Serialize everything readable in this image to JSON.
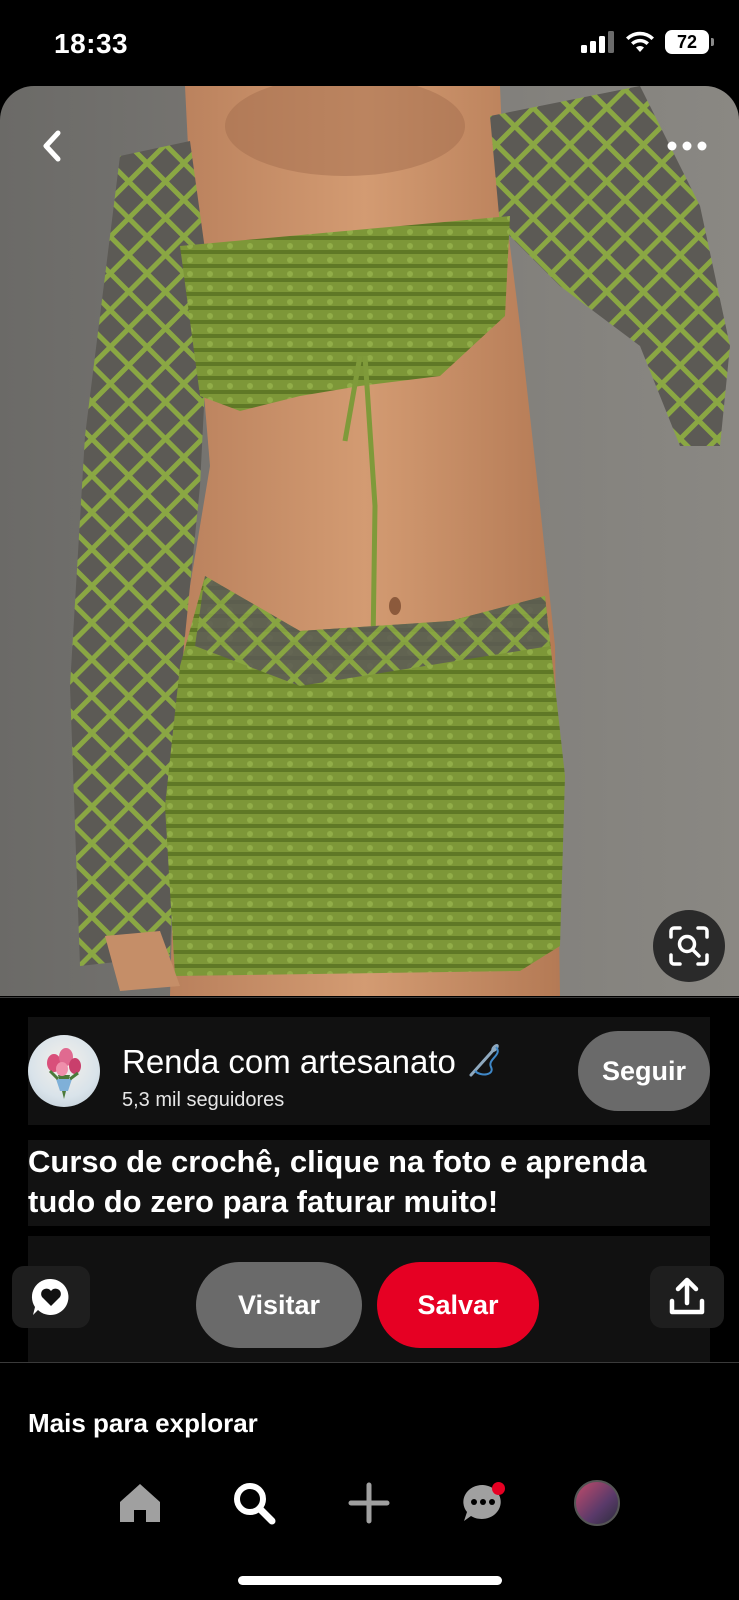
{
  "status_bar": {
    "time": "18:33",
    "battery": "72"
  },
  "pin": {
    "creator_name": "Renda com artesanato",
    "creator_followers": "5,3 mil seguidores",
    "follow_label": "Seguir",
    "description": "Curso de crochê, clique na foto e aprenda tudo do zero para faturar muito!",
    "visit_label": "Visitar",
    "save_label": "Salvar"
  },
  "explore": {
    "title": "Mais para explorar"
  },
  "icons": {
    "back": "chevron-left-icon",
    "more": "more-horizontal-icon",
    "lens": "visual-search-icon",
    "comment": "comment-heart-icon",
    "share": "share-icon",
    "home": "home-icon",
    "search": "search-icon",
    "create": "plus-icon",
    "messages": "chat-icon"
  },
  "colors": {
    "save_button": "#e60023",
    "neutral_button": "#6a6a6a",
    "background": "#000000",
    "yarn_green": "#7f9a3a"
  }
}
